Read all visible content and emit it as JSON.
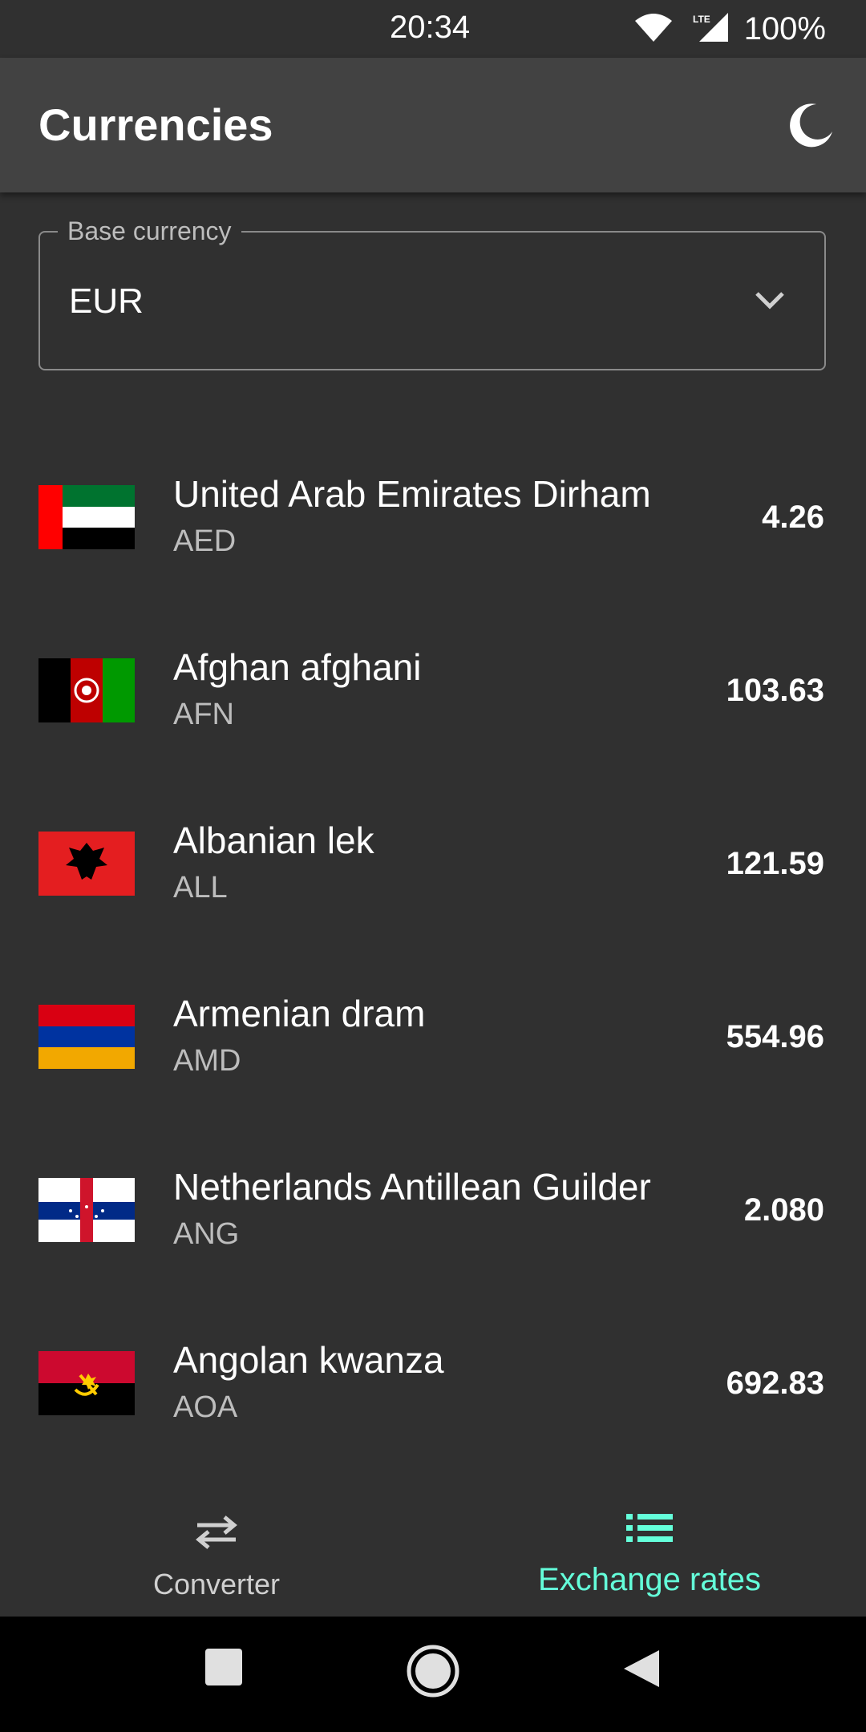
{
  "status_bar": {
    "time": "20:34",
    "network": "LTE",
    "battery": "100%"
  },
  "app_bar": {
    "title": "Currencies",
    "theme_icon": "moon-icon"
  },
  "base_currency": {
    "label": "Base currency",
    "value": "EUR",
    "icon": "chevron-down-icon"
  },
  "rates": [
    {
      "name": "United Arab Emirates Dirham",
      "code": "AED",
      "rate": "4.26",
      "flag": "flag-ae-icon"
    },
    {
      "name": "Afghan afghani",
      "code": "AFN",
      "rate": "103.63",
      "flag": "flag-af-icon"
    },
    {
      "name": "Albanian lek",
      "code": "ALL",
      "rate": "121.59",
      "flag": "flag-al-icon"
    },
    {
      "name": "Armenian dram",
      "code": "AMD",
      "rate": "554.96",
      "flag": "flag-am-icon"
    },
    {
      "name": "Netherlands Antillean Guilder",
      "code": "ANG",
      "rate": "2.080",
      "flag": "flag-an-icon"
    },
    {
      "name": "Angolan kwanza",
      "code": "AOA",
      "rate": "692.83",
      "flag": "flag-ao-icon"
    }
  ],
  "bottom_nav": {
    "items": [
      {
        "label": "Converter",
        "icon": "swap-arrows-icon",
        "active": false
      },
      {
        "label": "Exchange rates",
        "icon": "list-icon",
        "active": true
      }
    ]
  },
  "colors": {
    "background": "#303030",
    "app_bar": "#424242",
    "accent": "#64ffda",
    "secondary_text": "#bdbdbd"
  }
}
